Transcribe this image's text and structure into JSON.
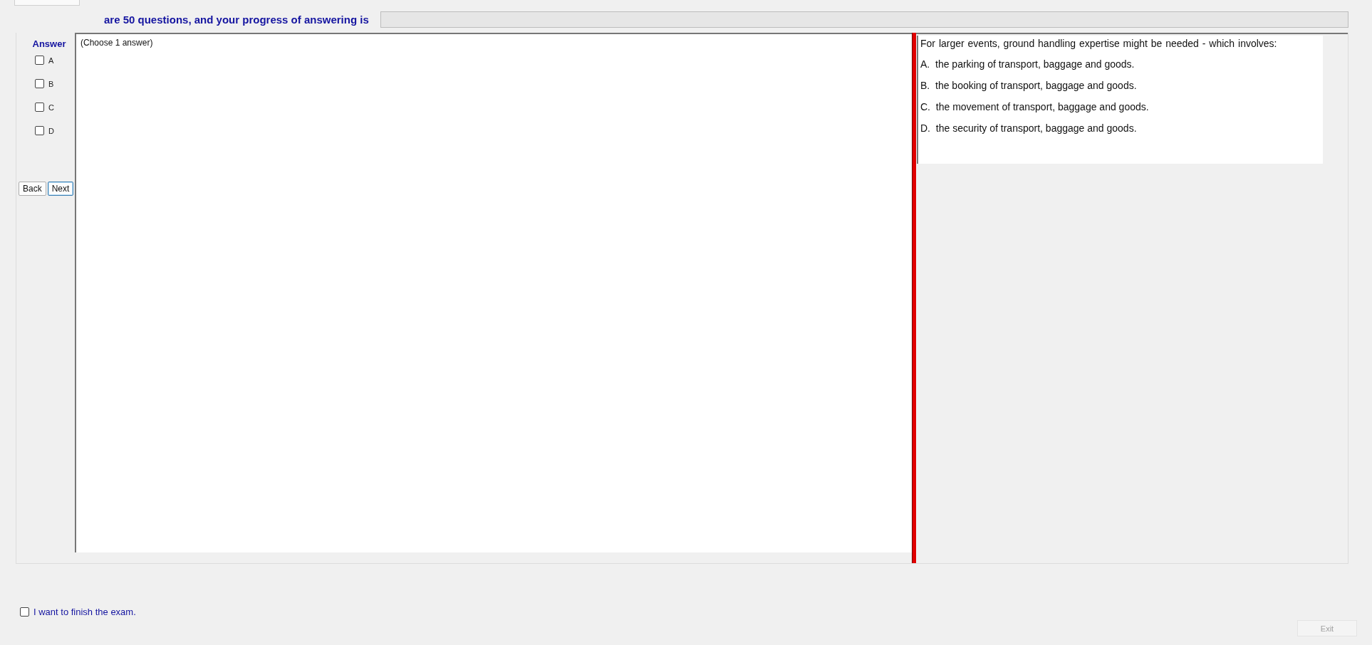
{
  "header": {
    "text": "are 50 questions, and your progress of answering is",
    "progress": {
      "level": 0
    }
  },
  "answer_panel": {
    "title": "Answer",
    "options": [
      {
        "label": "A",
        "checked": false
      },
      {
        "label": "B",
        "checked": false
      },
      {
        "label": "C",
        "checked": false
      },
      {
        "label": "D",
        "checked": false
      }
    ],
    "buttons": [
      {
        "label": "Back",
        "focused": false
      },
      {
        "label": "Next",
        "focused": true
      }
    ]
  },
  "question": {
    "instruction": "(Choose 1 answer)",
    "text": "For larger events, ground handling expertise might be needed - which involves:",
    "choices": [
      "A.  the parking of transport, baggage and goods.",
      "B.  the booking of transport, baggage and goods.",
      "C.  the movement of transport, baggage and goods.",
      "D.  the security of transport, baggage and goods."
    ]
  },
  "footer": {
    "finish": {
      "label": "I want to finish the exam.",
      "checked": false
    },
    "exit": {
      "label": "Exit",
      "disabled": true
    }
  }
}
